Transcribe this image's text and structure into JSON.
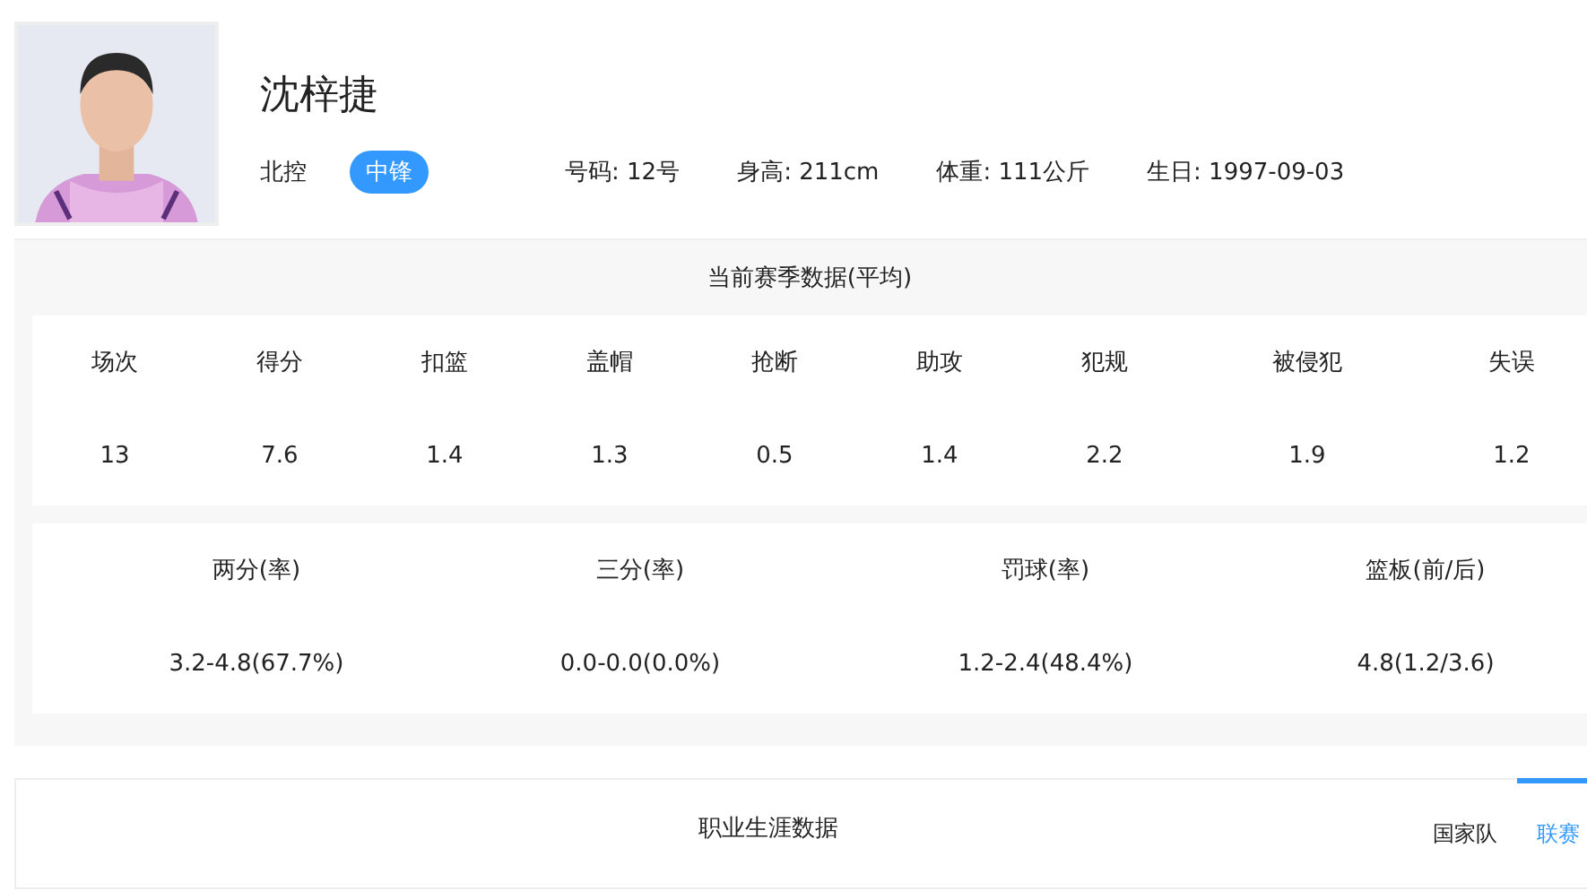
{
  "player": {
    "name": "沈梓捷",
    "team": "北控",
    "position": "中锋",
    "details": [
      "号码: 12号",
      "身高: 211cm",
      "体重: 111公斤",
      "生日: 1997-09-03"
    ]
  },
  "season": {
    "title": "当前赛季数据(平均)",
    "stats": [
      {
        "label": "场次",
        "value": "13"
      },
      {
        "label": "得分",
        "value": "7.6"
      },
      {
        "label": "扣篮",
        "value": "1.4"
      },
      {
        "label": "盖帽",
        "value": "1.3"
      },
      {
        "label": "抢断",
        "value": "0.5"
      },
      {
        "label": "助攻",
        "value": "1.4"
      },
      {
        "label": "犯规",
        "value": "2.2"
      },
      {
        "label": "被侵犯",
        "value": "1.9"
      },
      {
        "label": "失误",
        "value": "1.2"
      }
    ],
    "shooting": [
      {
        "label": "两分(率)",
        "value": "3.2-4.8(67.7%)"
      },
      {
        "label": "三分(率)",
        "value": "0.0-0.0(0.0%)"
      },
      {
        "label": "罚球(率)",
        "value": "1.2-2.4(48.4%)"
      },
      {
        "label": "篮板(前/后)",
        "value": "4.8(1.2/3.6)"
      }
    ]
  },
  "career": {
    "title": "职业生涯数据",
    "tabs": [
      {
        "label": "国家队",
        "selected": false
      },
      {
        "label": "联赛",
        "selected": true
      }
    ]
  }
}
